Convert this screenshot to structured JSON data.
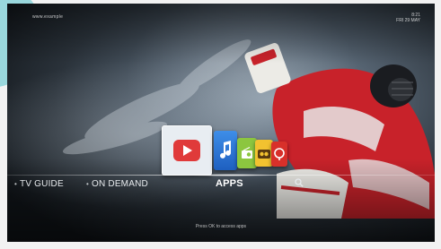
{
  "header": {
    "provider_name": "www.example",
    "clock_time": "8:21",
    "clock_date": "FRI 29 MAY"
  },
  "apps": [
    {
      "name": "video",
      "icon": "video-play-icon",
      "color": "#e03a3a"
    },
    {
      "name": "music",
      "icon": "music-note-icon",
      "color": "#2f7fd9"
    },
    {
      "name": "radio",
      "icon": "radio-icon",
      "color": "#8cc63f"
    },
    {
      "name": "camera",
      "icon": "camera-icon",
      "color": "#f2c230"
    },
    {
      "name": "phone",
      "icon": "phone-icon",
      "color": "#d8302a"
    }
  ],
  "nav": {
    "tv_guide": "TV GUIDE",
    "on_demand": "ON DEMAND",
    "apps": "APPS",
    "search_icon": "search-icon"
  },
  "hint": "Press OK to access apps"
}
